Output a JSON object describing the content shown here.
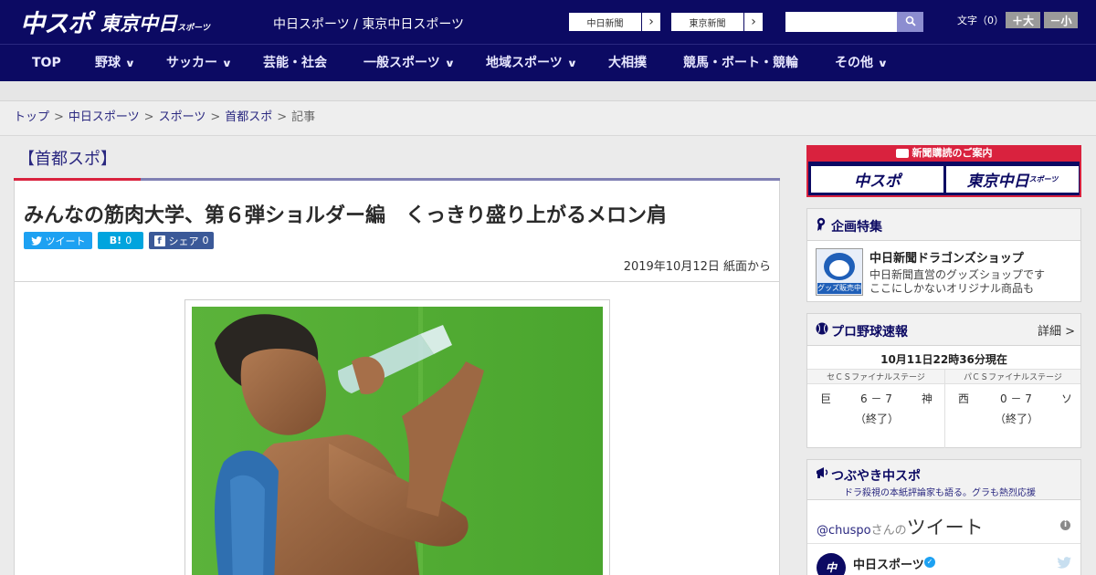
{
  "header": {
    "logo_main": "中スポ",
    "logo_sub": "東京中日",
    "logo_sub_small": "スポーツ",
    "tagline": "中日スポーツ / 東京中日スポーツ",
    "newspapers": [
      {
        "label": "中日新聞",
        "arrow": "›"
      },
      {
        "label": "東京新聞",
        "arrow": "›"
      }
    ],
    "search_placeholder": "",
    "search_icon": "search-icon",
    "font_size_label": "文字（0）",
    "font_larger": "＋大",
    "font_smaller": "－小"
  },
  "nav": {
    "items": [
      {
        "label": "TOP",
        "dropdown": ""
      },
      {
        "label": "野球",
        "dropdown": "∨"
      },
      {
        "label": "サッカー",
        "dropdown": "∨"
      },
      {
        "label": "芸能・社会",
        "dropdown": ""
      },
      {
        "label": "一般スポーツ",
        "dropdown": "∨"
      },
      {
        "label": "地域スポーツ",
        "dropdown": "∨"
      },
      {
        "label": "大相撲",
        "dropdown": ""
      },
      {
        "label": "競馬・ボート・競輪",
        "dropdown": ""
      },
      {
        "label": "その他",
        "dropdown": "∨"
      }
    ]
  },
  "breadcrumb": {
    "items": [
      "トップ",
      "中日スポーツ",
      "スポーツ",
      "首都スポ"
    ],
    "separator": ">",
    "current": "記事"
  },
  "article": {
    "category": "【首都スポ】",
    "title": "みんなの筋肉大学、第６弾ショルダー編　くっきり盛り上がるメロン肩",
    "share": {
      "tweet_label": "ツイート",
      "hatena_label": "B!",
      "hatena_count": "0",
      "facebook_label": "シェア",
      "facebook_count": "0"
    },
    "date": "2019年10月12日 紙面から"
  },
  "sidebar": {
    "subscribe": {
      "header": "新聞購読のご案内",
      "left": "中スポ",
      "right": "東京中日",
      "right_small": "スポーツ"
    },
    "special": {
      "heading": "企画特集",
      "item_title": "中日新聞ドラゴンズショップ",
      "item_line1": "中日新聞直営のグッズショップです",
      "item_line2": "ここにしかないオリジナル商品も",
      "thumb_label": "グッズ販売中"
    },
    "baseball": {
      "heading": "プロ野球速報",
      "detail": "詳細 >",
      "time": "10月11日22時36分現在",
      "games": [
        {
          "stage": "セＣＳファイナルステージ",
          "home": "巨",
          "score": "6 － 7",
          "away": "神",
          "status": "（終了）"
        },
        {
          "stage": "パＣＳファイナルステージ",
          "home": "西",
          "score": "0 － 7",
          "away": "ソ",
          "status": "（終了）"
        }
      ]
    },
    "tweets": {
      "heading": "つぶやき中スポ",
      "sub": "ドラ殺視の本紙評論家も語る。グラも熱烈応援",
      "handle": "@chuspo",
      "handle_suffix": "さんの",
      "tweet_word": "ツイート",
      "account": "中日スポーツ"
    }
  },
  "colors": {
    "brand_navy": "#0c0a63",
    "accent_red": "#d9223e",
    "twitter_blue": "#1da1f2",
    "hatena_blue": "#00a4de",
    "facebook_blue": "#3b5998"
  }
}
